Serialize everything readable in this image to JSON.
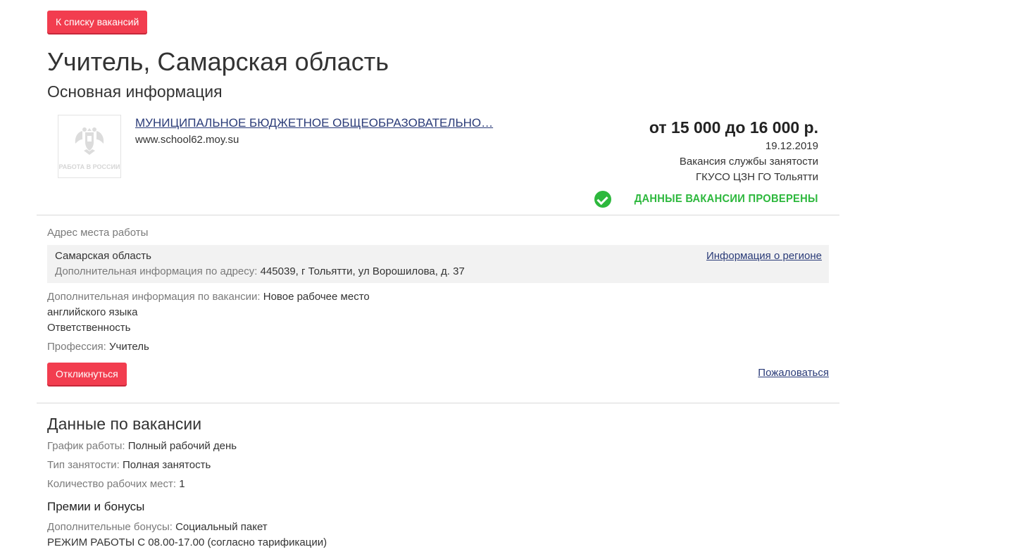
{
  "back_button_label": "К списку вакансий",
  "title": "Учитель, Самарская область",
  "subtitle": "Основная информация",
  "employer": {
    "logo_text": "РАБОТА В РОССИИ",
    "name": "МУНИЦИПАЛЬНОЕ БЮДЖЕТНОЕ ОБЩЕОБРАЗОВАТЕЛЬНО…",
    "site": "www.school62.moy.su"
  },
  "summary": {
    "salary": "от 15 000 до 16 000 р.",
    "date": "19.12.2019",
    "source": "Вакансия службы занятости",
    "agency": "ГКУСО ЦЗН ГО Тольятти",
    "verified": "Данные вакансии проверены"
  },
  "address": {
    "label": "Адрес места работы",
    "region": "Самарская область",
    "extra_label": "Дополнительная информация по адресу:",
    "extra_value": "445039, г Тольятти, ул Ворошилова, д. 37",
    "region_link": "Информация о регионе"
  },
  "vacancy_info": {
    "label": "Дополнительная информация по вакансии:",
    "value_line1": "Новое рабочее место",
    "value_line2": "английского языка",
    "value_line3": "Ответственность"
  },
  "profession": {
    "label": "Профессия:",
    "value": "Учитель"
  },
  "apply_button_label": "Откликнуться",
  "complain_link": "Пожаловаться",
  "details": {
    "title": "Данные по вакансии",
    "schedule_label": "График работы:",
    "schedule_value": "Полный рабочий день",
    "employment_label": "Тип занятости:",
    "employment_value": "Полная занятость",
    "positions_label": "Количество рабочих мест:",
    "positions_value": "1"
  },
  "bonuses": {
    "title": "Премии и бонусы",
    "label": "Дополнительные бонусы:",
    "value": "Социальный пакет",
    "note": "РЕЖИМ РАБОТЫ С 08.00-17.00 (согласно тарификации)"
  },
  "colors": {
    "accent_red": "#f23d4f",
    "link_blue": "#2a3b78",
    "verified_green": "#2db83d"
  },
  "icons": {
    "logo": "russian-eagle-emblem",
    "verified": "check-circle-icon"
  }
}
